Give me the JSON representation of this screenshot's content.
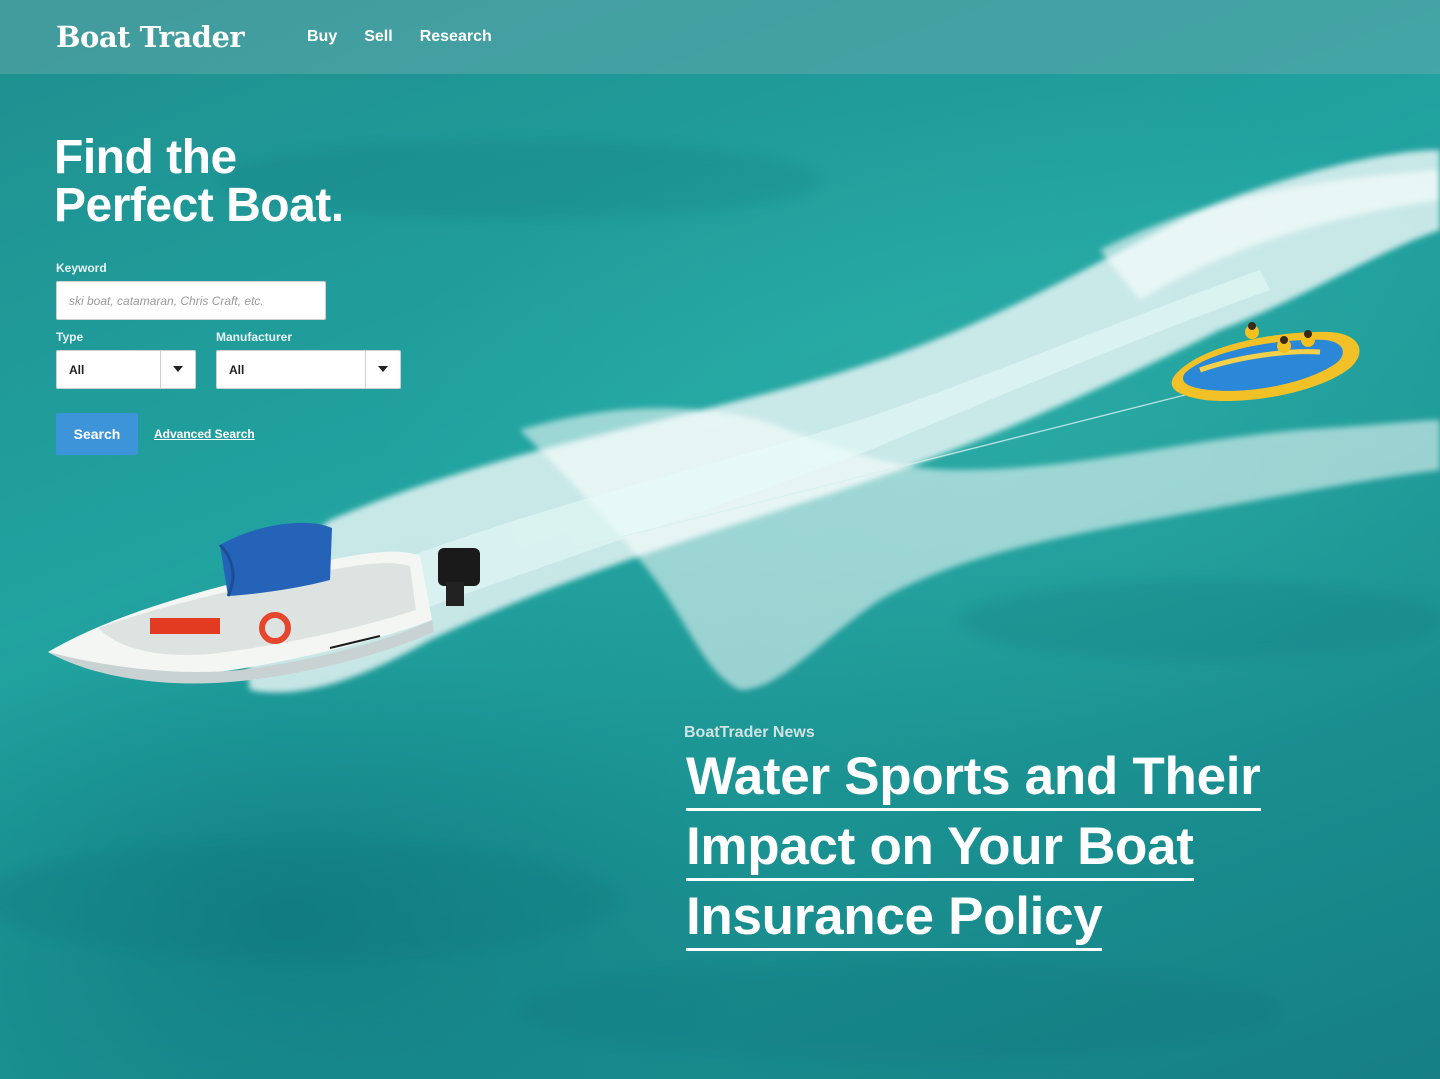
{
  "header": {
    "logo": "Boat Trader",
    "nav": [
      {
        "label": "Buy"
      },
      {
        "label": "Sell"
      },
      {
        "label": "Research"
      }
    ]
  },
  "hero": {
    "title_line1": "Find the",
    "title_line2": "Perfect Boat."
  },
  "search": {
    "keyword_label": "Keyword",
    "keyword_placeholder": "ski boat, catamaran, Chris Craft, etc.",
    "keyword_value": "",
    "type_label": "Type",
    "type_value": "All",
    "manufacturer_label": "Manufacturer",
    "manufacturer_value": "All",
    "search_button": "Search",
    "advanced_link": "Advanced Search"
  },
  "news": {
    "label": "BoatTrader News",
    "headline": "Water Sports and Their Impact on Your Boat Insurance Policy"
  },
  "colors": {
    "water": "#1e9a98",
    "search_button": "#3d94d8",
    "header_overlay": "#6eaaaf"
  },
  "icons": {
    "select_arrow": "chevron-down-icon"
  }
}
